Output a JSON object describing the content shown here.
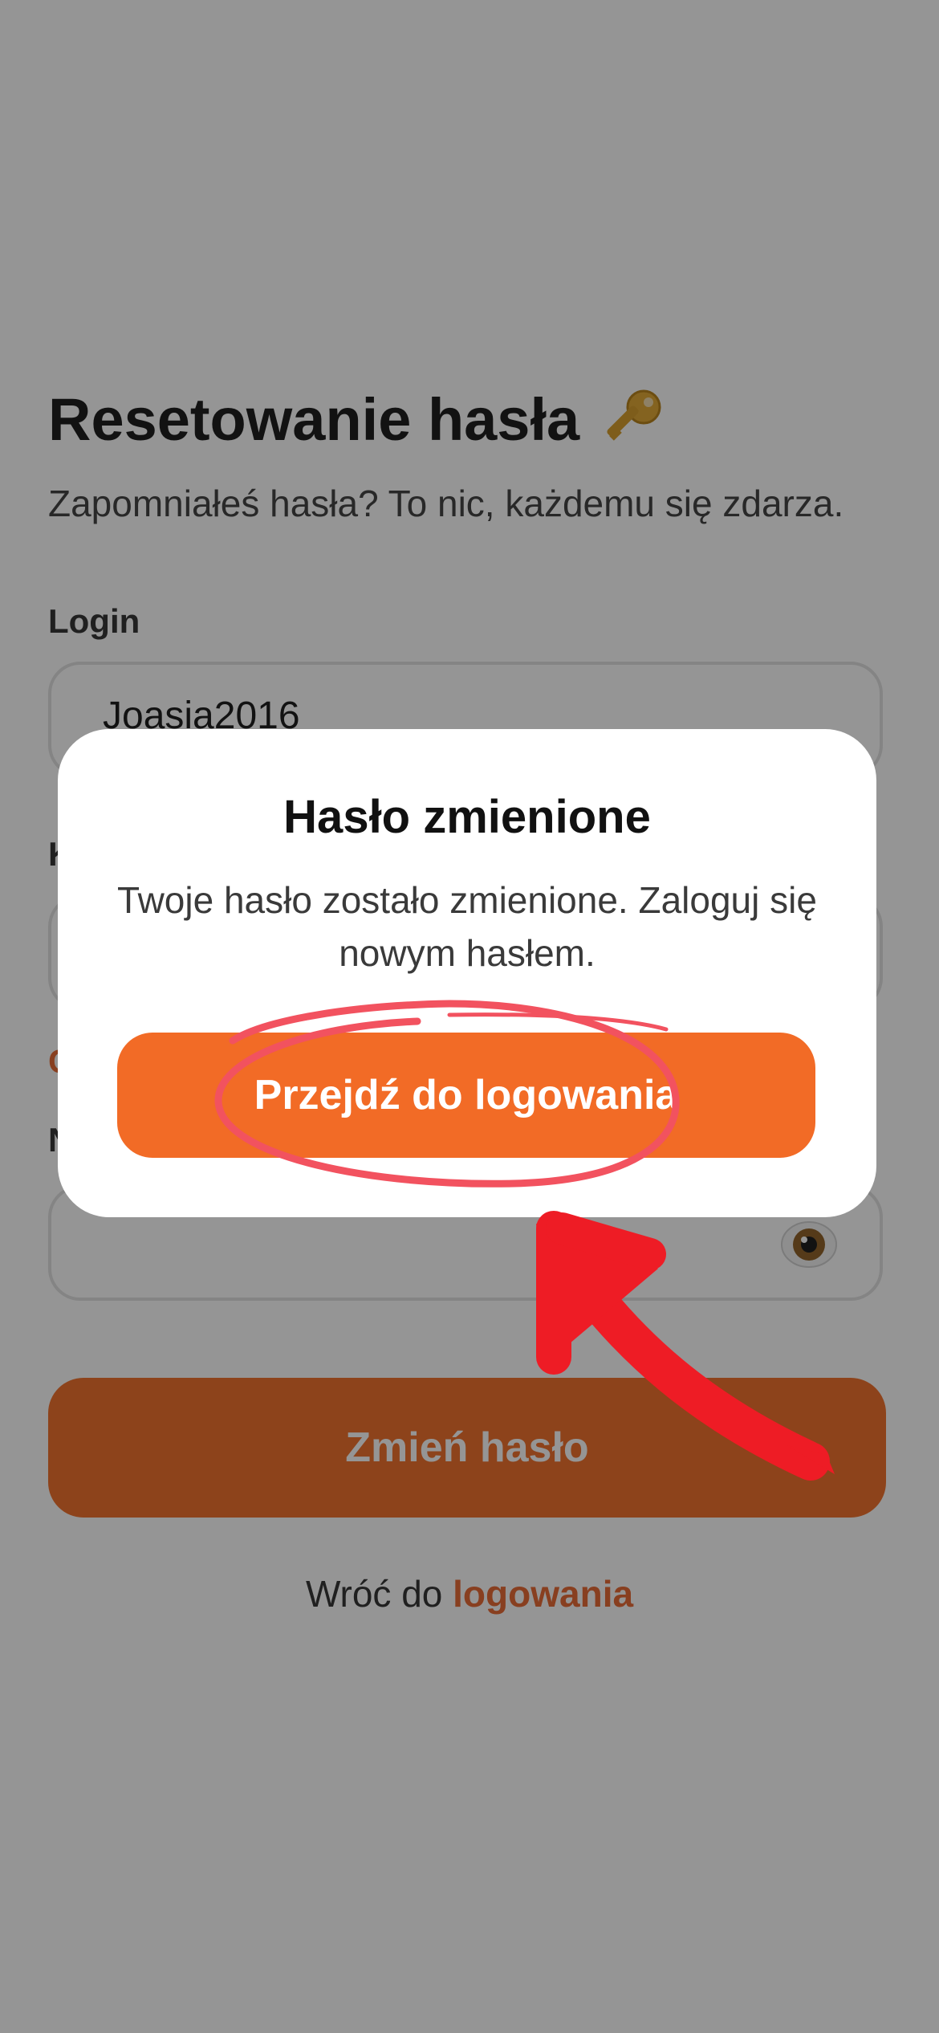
{
  "screen": {
    "title": "Resetowanie hasła",
    "subtitle": "Zapomniałeś hasła? To nic, każdemu się zdarza.",
    "login_label": "Login",
    "login_value": "Joasia2016",
    "second_label_initial": "K",
    "hint_initial": "C",
    "third_label_initial": "N",
    "submit_button": "Zmień hasło",
    "back_text": "Wróć do",
    "back_link": "logowania"
  },
  "modal": {
    "title": "Hasło zmienione",
    "message": "Twoje hasło zostało zmienione. Zaloguj się nowym hasłem.",
    "button": "Przejdź do logowania"
  },
  "icons": {
    "title_icon": "key-icon",
    "password_toggle": "eye-icon"
  },
  "colors": {
    "accent": "#f06a22",
    "link": "#e8632a",
    "annotation": "#ee1c25"
  }
}
